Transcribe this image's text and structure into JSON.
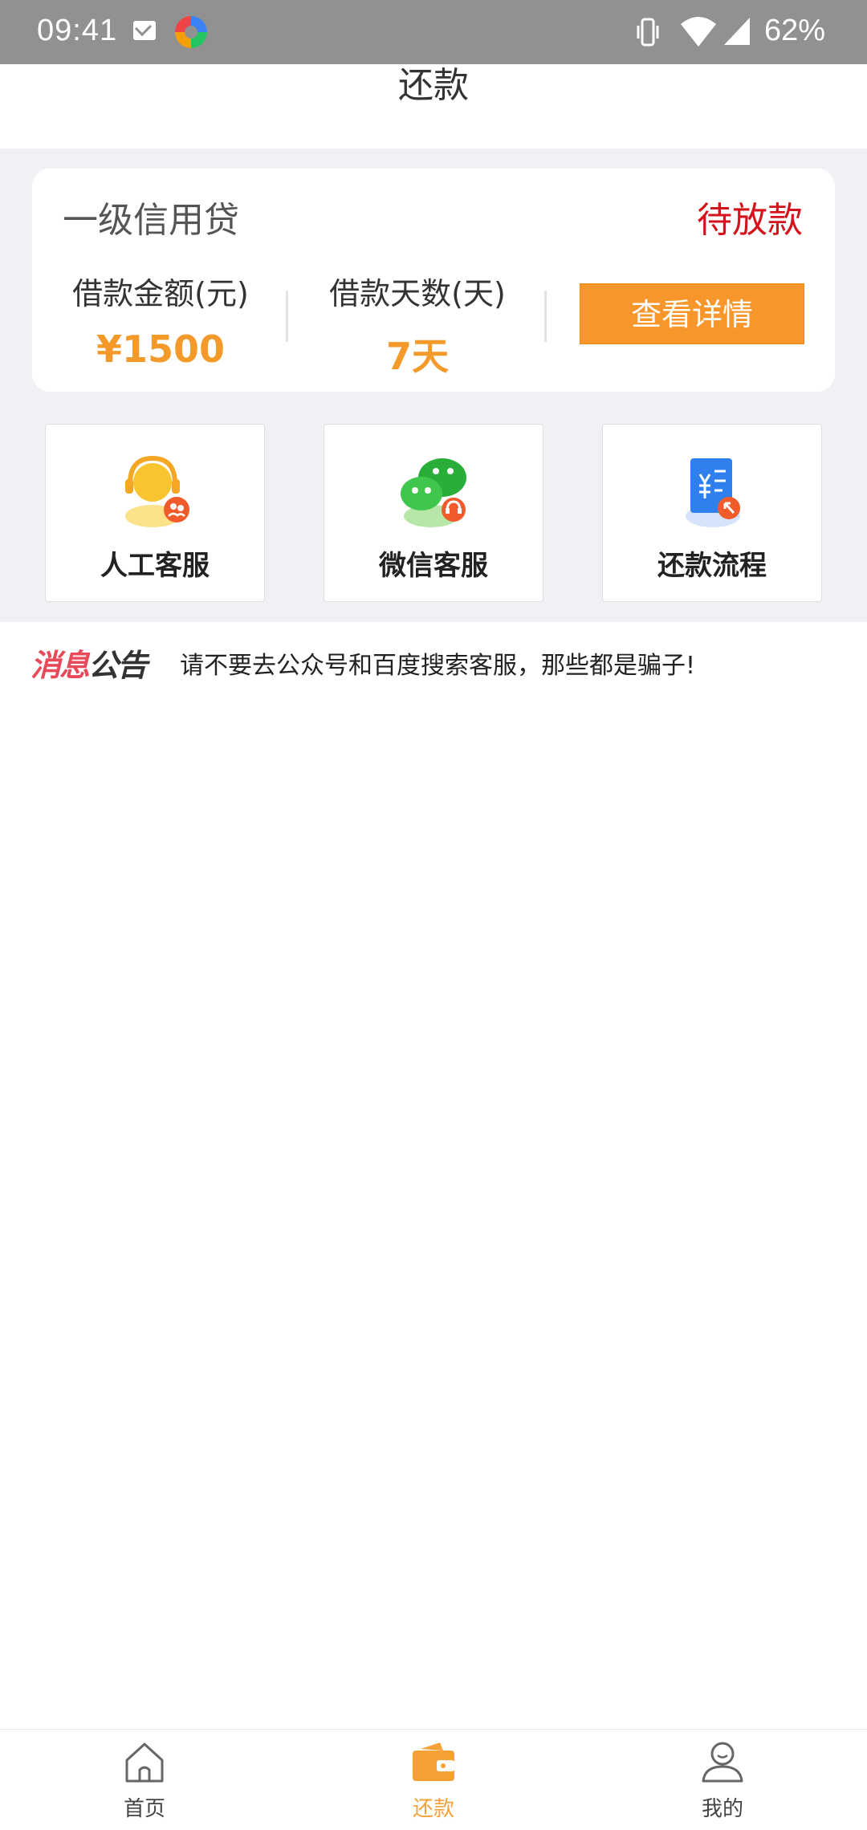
{
  "status_bar": {
    "time": "09:41",
    "battery": "62%"
  },
  "header": {
    "title": "还款"
  },
  "loan": {
    "type": "一级信用贷",
    "status": "待放款",
    "amount_label": "借款金额(元)",
    "amount_value": "¥1500",
    "days_label": "借款天数(天)",
    "days_value": "7天",
    "detail_button": "查看详情"
  },
  "services": [
    {
      "label": "人工客服",
      "icon": "customer-service-headset-icon"
    },
    {
      "label": "微信客服",
      "icon": "wechat-icon"
    },
    {
      "label": "还款流程",
      "icon": "repayment-document-icon"
    }
  ],
  "notice": {
    "logo_part1": "消息",
    "logo_part2": "公告",
    "text": "请不要去公众号和百度搜索客服，那些都是骗子!"
  },
  "bottom_nav": [
    {
      "label": "首页",
      "icon": "home-icon",
      "active": false
    },
    {
      "label": "还款",
      "icon": "wallet-icon",
      "active": true
    },
    {
      "label": "我的",
      "icon": "user-icon",
      "active": false
    }
  ],
  "colors": {
    "accent": "#f7962b",
    "status_red": "#d4141c",
    "background_grey": "#eff1f5"
  }
}
